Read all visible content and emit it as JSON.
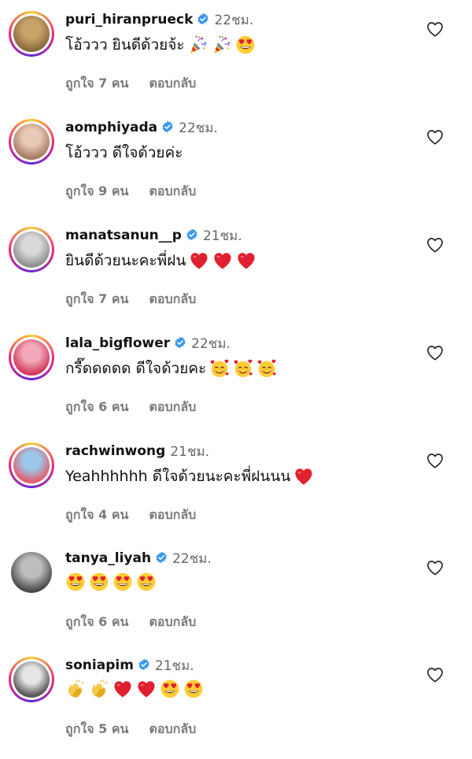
{
  "comments": [
    {
      "username": "puri_hiranprueck",
      "verified": true,
      "time": "22ชม.",
      "text": "โอ้ววว ยินดีด้วยจ้ะ",
      "emojis": [
        "party-popper-icon",
        "party-popper-icon",
        "heart-eyes-icon"
      ],
      "likes": "ถูกใจ 7 คน",
      "reply": "ตอบกลับ",
      "story_ring": true
    },
    {
      "username": "aomphiyada",
      "verified": true,
      "time": "22ชม.",
      "text": "โอ้ววว ดีใจด้วยค่ะ",
      "emojis": [],
      "likes": "ถูกใจ 9 คน",
      "reply": "ตอบกลับ",
      "story_ring": true
    },
    {
      "username": "manatsanun__p",
      "verified": true,
      "time": "21ชม.",
      "text": "ยินดีด้วยนะคะพี่ฝน",
      "emojis": [
        "red-heart-icon",
        "red-heart-icon",
        "red-heart-icon"
      ],
      "likes": "ถูกใจ 7 คน",
      "reply": "ตอบกลับ",
      "story_ring": true
    },
    {
      "username": "lala_bigflower",
      "verified": true,
      "time": "22ชม.",
      "text": "กรี๊ดดดดด ดีใจด้วยคะ",
      "emojis": [
        "smiling-face-with-hearts-icon",
        "smiling-face-with-hearts-icon",
        "smiling-face-with-hearts-icon"
      ],
      "likes": "ถูกใจ 6 คน",
      "reply": "ตอบกลับ",
      "story_ring": true
    },
    {
      "username": "rachwinwong",
      "verified": false,
      "time": "21ชม.",
      "text": "Yeahhhhhh ดีใจด้วยนะคะพี่ฝนนน",
      "emojis": [
        "red-heart-icon"
      ],
      "likes": "ถูกใจ 4 คน",
      "reply": "ตอบกลับ",
      "story_ring": true
    },
    {
      "username": "tanya_liyah",
      "verified": true,
      "time": "22ชม.",
      "text": "",
      "emojis": [
        "heart-eyes-icon",
        "heart-eyes-icon",
        "heart-eyes-icon",
        "heart-eyes-icon"
      ],
      "likes": "ถูกใจ 6 คน",
      "reply": "ตอบกลับ",
      "story_ring": false
    },
    {
      "username": "soniapim",
      "verified": true,
      "time": "21ชม.",
      "text": "",
      "emojis": [
        "clapping-hands-icon",
        "clapping-hands-icon",
        "red-heart-icon",
        "red-heart-icon",
        "heart-eyes-icon",
        "heart-eyes-icon"
      ],
      "likes": "ถูกใจ 5 คน",
      "reply": "ตอบกลับ",
      "story_ring": true
    }
  ],
  "colors": {
    "verified": "#3897f0",
    "heart": "#e0202e",
    "emoji_face": "#ffcc33",
    "muted_text": "#7a7a7a"
  }
}
